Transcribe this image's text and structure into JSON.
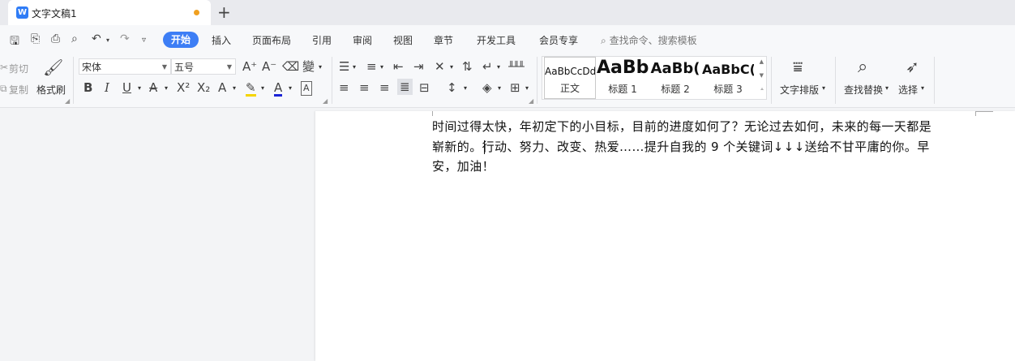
{
  "tab": {
    "title": "文字文稿1"
  },
  "menu": {
    "active": "开始",
    "items": [
      "插入",
      "页面布局",
      "引用",
      "审阅",
      "视图",
      "章节",
      "开发工具",
      "会员专享"
    ],
    "search_placeholder": "查找命令、搜索模板"
  },
  "ribbon": {
    "cut": "剪切",
    "copy": "复制",
    "format_painter": "格式刷",
    "font_name": "宋体",
    "font_size": "五号",
    "styles": [
      {
        "sample": "AaBbCcDd",
        "name": "正文"
      },
      {
        "sample": "AaBb",
        "name": "标题 1"
      },
      {
        "sample": "AaBb(",
        "name": "标题 2"
      },
      {
        "sample": "AaBbC(",
        "name": "标题 3"
      }
    ],
    "text_layout": "文字排版",
    "find_replace": "查找替换",
    "select": "选择"
  },
  "document": {
    "line1": "时间过得太快，年初定下的小目标，目前的进度如何了？无论过去如何，未来的每一天都是",
    "line2": "崭新的。行动、努力、改变、热爱……提升自我的 9 个关键词↓↓↓送给不甘平庸的你。早",
    "line3": "安，加油！"
  }
}
